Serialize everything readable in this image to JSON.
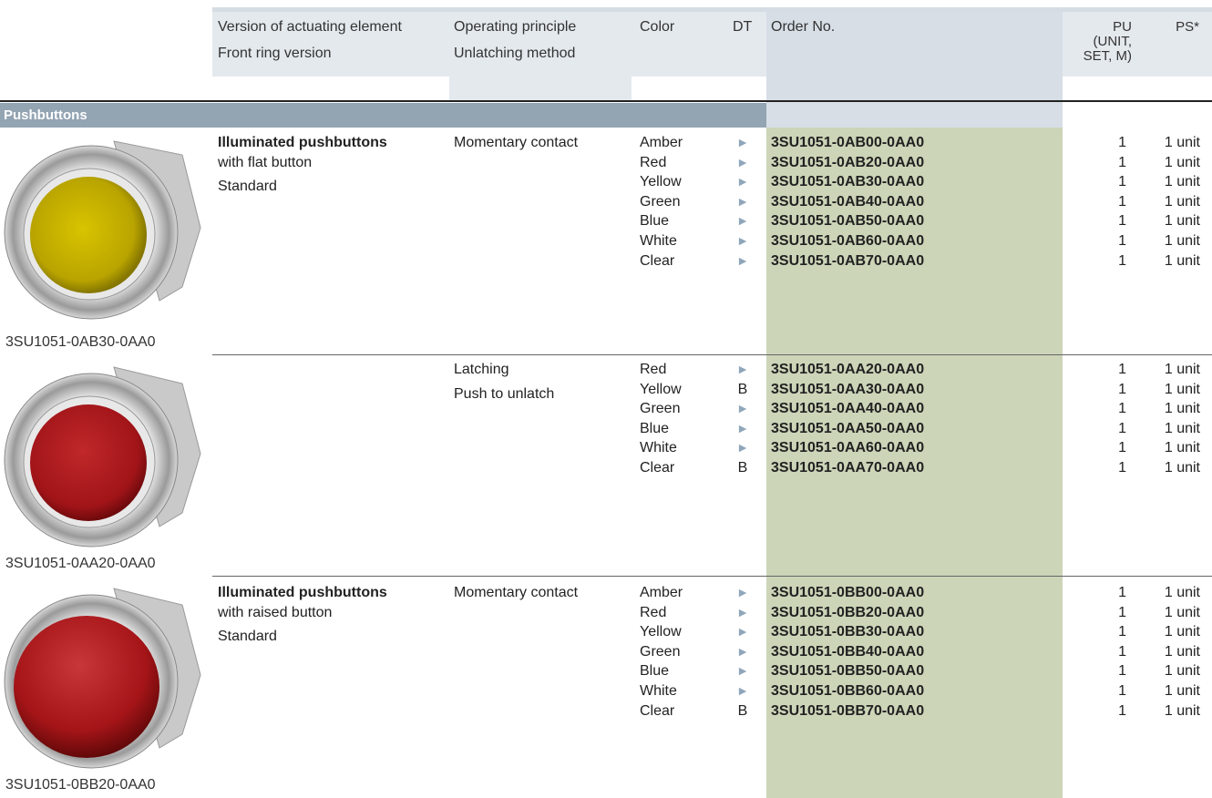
{
  "header": {
    "version_line1": "Version of actuating element",
    "version_line2": "Front ring version",
    "principle_line1": "Operating principle",
    "principle_line2": "Unlatching method",
    "color": "Color",
    "dt": "DT",
    "order_no": "Order No.",
    "pu": "PU\n(UNIT,\nSET, M)",
    "ps": "PS*"
  },
  "section_title": "Pushbuttons",
  "groups": [
    {
      "caption": "3SU1051-0AB30-0AA0",
      "title": "Illuminated pushbuttons",
      "subtitle": "with flat button",
      "version": "Standard",
      "principle": "Momentary contact",
      "unlatch": "",
      "rows": [
        {
          "color": "Amber",
          "dt": "►",
          "order": "3SU1051-0AB00-0AA0",
          "pu": "1",
          "ps": "1 unit"
        },
        {
          "color": "Red",
          "dt": "►",
          "order": "3SU1051-0AB20-0AA0",
          "pu": "1",
          "ps": "1 unit"
        },
        {
          "color": "Yellow",
          "dt": "►",
          "order": "3SU1051-0AB30-0AA0",
          "pu": "1",
          "ps": "1 unit"
        },
        {
          "color": "Green",
          "dt": "►",
          "order": "3SU1051-0AB40-0AA0",
          "pu": "1",
          "ps": "1 unit"
        },
        {
          "color": "Blue",
          "dt": "►",
          "order": "3SU1051-0AB50-0AA0",
          "pu": "1",
          "ps": "1 unit"
        },
        {
          "color": "White",
          "dt": "►",
          "order": "3SU1051-0AB60-0AA0",
          "pu": "1",
          "ps": "1 unit"
        },
        {
          "color": "Clear",
          "dt": "►",
          "order": "3SU1051-0AB70-0AA0",
          "pu": "1",
          "ps": "1 unit"
        }
      ]
    },
    {
      "caption": "3SU1051-0AA20-0AA0",
      "title": "",
      "subtitle": "",
      "version": "",
      "principle": "Latching",
      "unlatch": "Push to unlatch",
      "rows": [
        {
          "color": "Red",
          "dt": "►",
          "order": "3SU1051-0AA20-0AA0",
          "pu": "1",
          "ps": "1 unit"
        },
        {
          "color": "Yellow",
          "dt": "B",
          "order": "3SU1051-0AA30-0AA0",
          "pu": "1",
          "ps": "1 unit"
        },
        {
          "color": "Green",
          "dt": "►",
          "order": "3SU1051-0AA40-0AA0",
          "pu": "1",
          "ps": "1 unit"
        },
        {
          "color": "Blue",
          "dt": "►",
          "order": "3SU1051-0AA50-0AA0",
          "pu": "1",
          "ps": "1 unit"
        },
        {
          "color": "White",
          "dt": "►",
          "order": "3SU1051-0AA60-0AA0",
          "pu": "1",
          "ps": "1 unit"
        },
        {
          "color": "Clear",
          "dt": "B",
          "order": "3SU1051-0AA70-0AA0",
          "pu": "1",
          "ps": "1 unit"
        }
      ]
    },
    {
      "caption": "3SU1051-0BB20-0AA0",
      "title": "Illuminated pushbuttons",
      "subtitle": "with raised button",
      "version": "Standard",
      "principle": "Momentary contact",
      "unlatch": "",
      "rows": [
        {
          "color": "Amber",
          "dt": "►",
          "order": "3SU1051-0BB00-0AA0",
          "pu": "1",
          "ps": "1 unit"
        },
        {
          "color": "Red",
          "dt": "►",
          "order": "3SU1051-0BB20-0AA0",
          "pu": "1",
          "ps": "1 unit"
        },
        {
          "color": "Yellow",
          "dt": "►",
          "order": "3SU1051-0BB30-0AA0",
          "pu": "1",
          "ps": "1 unit"
        },
        {
          "color": "Green",
          "dt": "►",
          "order": "3SU1051-0BB40-0AA0",
          "pu": "1",
          "ps": "1 unit"
        },
        {
          "color": "Blue",
          "dt": "►",
          "order": "3SU1051-0BB50-0AA0",
          "pu": "1",
          "ps": "1 unit"
        },
        {
          "color": "White",
          "dt": "►",
          "order": "3SU1051-0BB60-0AA0",
          "pu": "1",
          "ps": "1 unit"
        },
        {
          "color": "Clear",
          "dt": "B",
          "order": "3SU1051-0BB70-0AA0",
          "pu": "1",
          "ps": "1 unit"
        }
      ]
    }
  ],
  "colors": {
    "header_bg": "#e4e9ee",
    "section_bar": "#93a4b3",
    "order_column_bg": "#ccd5b8",
    "arrow": "#8fa6ba",
    "lens_amber": "#c9b400",
    "lens_red": "#a51518"
  }
}
